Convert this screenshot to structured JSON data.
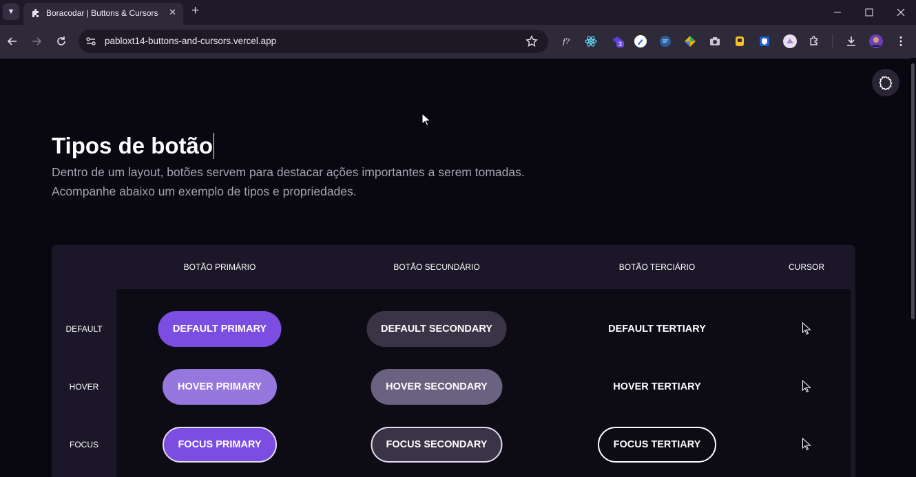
{
  "browser": {
    "tab_title": "Boracodar | Buttons & Cursors",
    "url": "pabloxt14-buttons-and-cursors.vercel.app",
    "extension_badge": "3",
    "extension_fx_label": "f?"
  },
  "page": {
    "title": "Tipos de botão",
    "description_line1": "Dentro de um layout, botões servem para destacar ações importantes a serem tomadas.",
    "description_line2": "Acompanhe abaixo um exemplo de tipos e propriedades."
  },
  "table": {
    "columns": [
      "Botão primário",
      "Botão secundário",
      "Botão terciário",
      "Cursor"
    ],
    "rows": [
      {
        "label": "Default",
        "primary": "Default Primary",
        "secondary": "Default Secondary",
        "tertiary": "Default Tertiary",
        "cursor": "pointer-icon"
      },
      {
        "label": "Hover",
        "primary": "Hover Primary",
        "secondary": "Hover Secondary",
        "tertiary": "Hover Tertiary",
        "cursor": "pointer-icon"
      },
      {
        "label": "Focus",
        "primary": "Focus Primary",
        "secondary": "Focus Secondary",
        "tertiary": "Focus Tertiary",
        "cursor": "pointer-icon"
      }
    ]
  },
  "colors": {
    "background": "#09070f",
    "panel": "#1c1728",
    "primary": "#7b4de0",
    "primary_hover": "#9677de",
    "secondary": "#3b3447",
    "secondary_hover": "#6b6180",
    "focus_ring": "#e6dcf7"
  },
  "icons": {
    "settings": "gear-icon",
    "star": "star-icon",
    "site_info": "tune-icon"
  }
}
